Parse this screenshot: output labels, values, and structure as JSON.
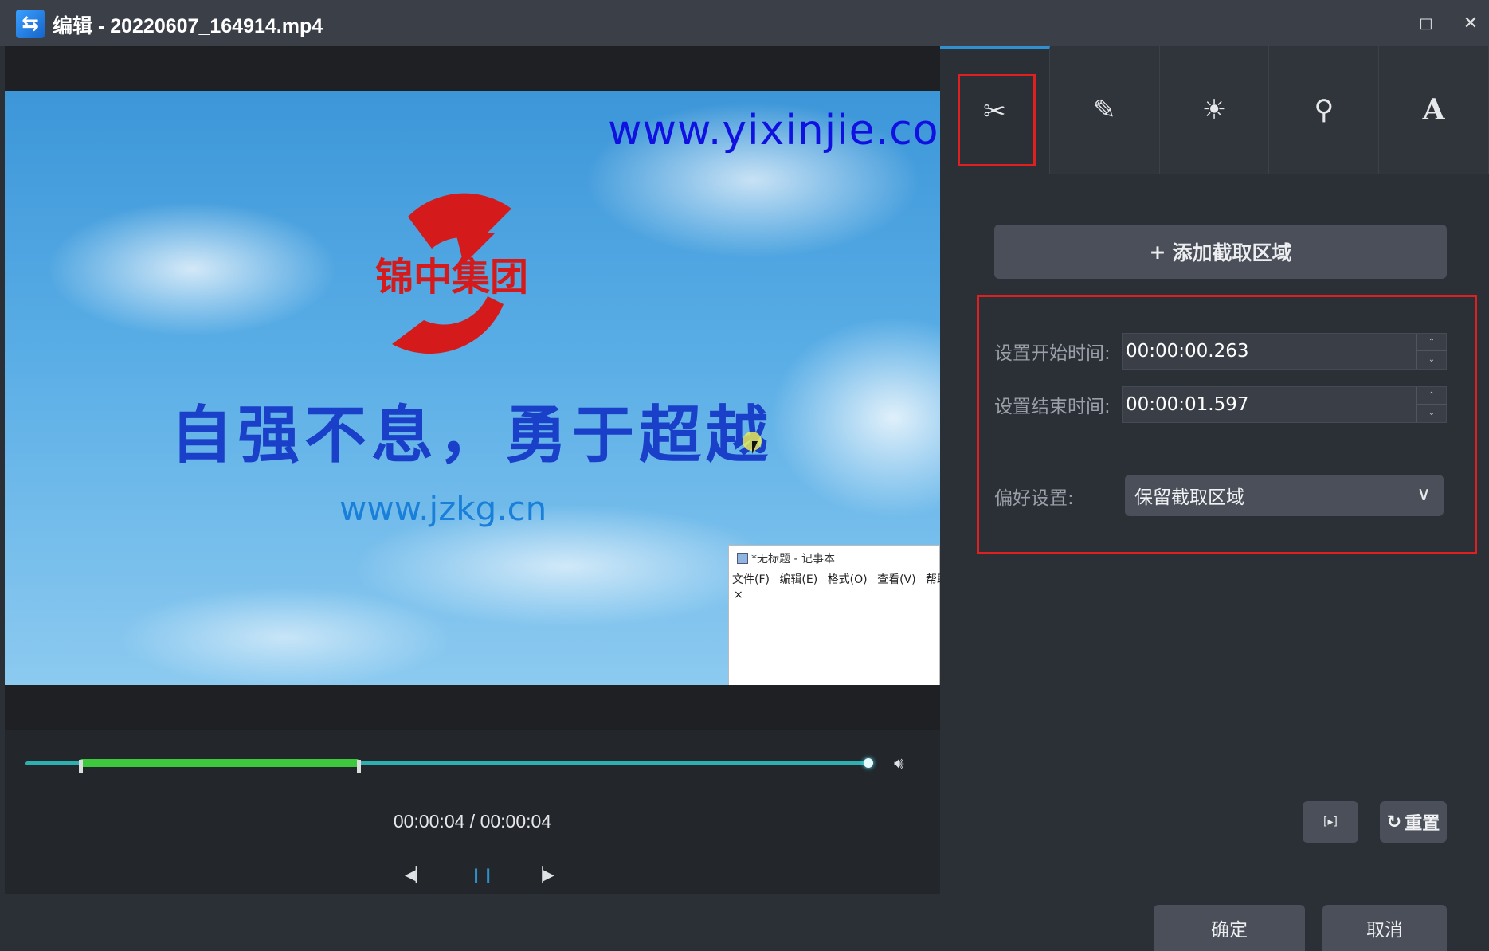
{
  "window": {
    "title": "编辑 - 20220607_164914.mp4",
    "icon": "app-logo-icon",
    "maximize_icon": "□",
    "close_icon": "✕"
  },
  "video": {
    "watermark": "www.yixinjie.com",
    "logo_text": "锦中集团",
    "slogan": "自强不息，勇于超越",
    "site_url": "www.jzkg.cn",
    "notepad": {
      "title": "*无标题 - 记事本",
      "menu": [
        "文件(F)",
        "编辑(E)",
        "格式(O)",
        "查看(V)",
        "帮助(H"
      ],
      "content": "×"
    }
  },
  "player": {
    "time_display": "00:00:04 / 00:00:04",
    "selection_start_fraction": 0.065,
    "selection_end_fraction": 0.395,
    "playhead_fraction": 1.0,
    "prev_icon": "step-back-icon",
    "pause_icon": "pause-icon",
    "next_icon": "step-forward-icon",
    "volume_icon": "volume-icon"
  },
  "tabs": [
    {
      "name": "cut",
      "icon": "scissors-icon",
      "glyph": "✂",
      "active": true
    },
    {
      "name": "effects",
      "icon": "magic-wand-icon",
      "glyph": "✎",
      "active": false
    },
    {
      "name": "adjust",
      "icon": "brightness-icon",
      "glyph": "☀",
      "active": false
    },
    {
      "name": "watermark",
      "icon": "stamp-icon",
      "glyph": "⚲",
      "active": false
    },
    {
      "name": "text",
      "icon": "text-icon",
      "glyph": "A",
      "active": false
    }
  ],
  "trim": {
    "add_region_label": "添加截取区域",
    "add_region_icon": "+",
    "start_label": "设置开始时间:",
    "start_value": "00:00:00.263",
    "end_label": "设置结束时间:",
    "end_value": "00:00:01.597",
    "pref_label": "偏好设置:",
    "pref_value": "保留截取区域",
    "spinner_up": "⌃",
    "spinner_down": "⌄",
    "chevron": "∨"
  },
  "actions": {
    "preview_icon": "[▸]",
    "reset_icon": "↻",
    "reset_label": "重置",
    "ok_label": "确定",
    "cancel_label": "取消"
  },
  "colors": {
    "accent_red": "#e02020",
    "accent_blue": "#2f8fd0",
    "selection_green": "#3ec83e",
    "track_teal": "#2fb0b0"
  }
}
